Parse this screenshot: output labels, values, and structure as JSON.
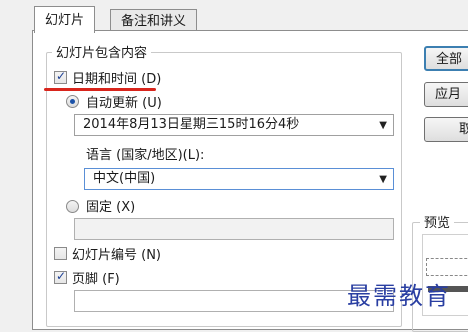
{
  "tabs": [
    "幻灯片",
    "备注和讲义"
  ],
  "group_title": "幻灯片包含内容",
  "date_time": {
    "label": "日期和时间 (D)",
    "checked": true
  },
  "auto_update": {
    "label": "自动更新 (U)",
    "selected": true,
    "value": "2014年8月13日星期三15时16分4秒"
  },
  "language": {
    "label": "语言 (国家/地区)(L):",
    "value": "中文(中国)"
  },
  "fixed": {
    "label": "固定 (X)",
    "selected": false,
    "value": ""
  },
  "slide_number": {
    "label": "幻灯片编号 (N)",
    "checked": false
  },
  "footer": {
    "label": "页脚 (F)",
    "checked": true,
    "value": ""
  },
  "buttons": [
    "全部",
    "应月",
    "取"
  ],
  "preview_label": "预览",
  "watermark": "最需教育",
  "colors": {
    "accent_red": "#d8251c",
    "checkmark_blue": "#1c3f94",
    "watermark_blue": "#2a3fa2"
  }
}
